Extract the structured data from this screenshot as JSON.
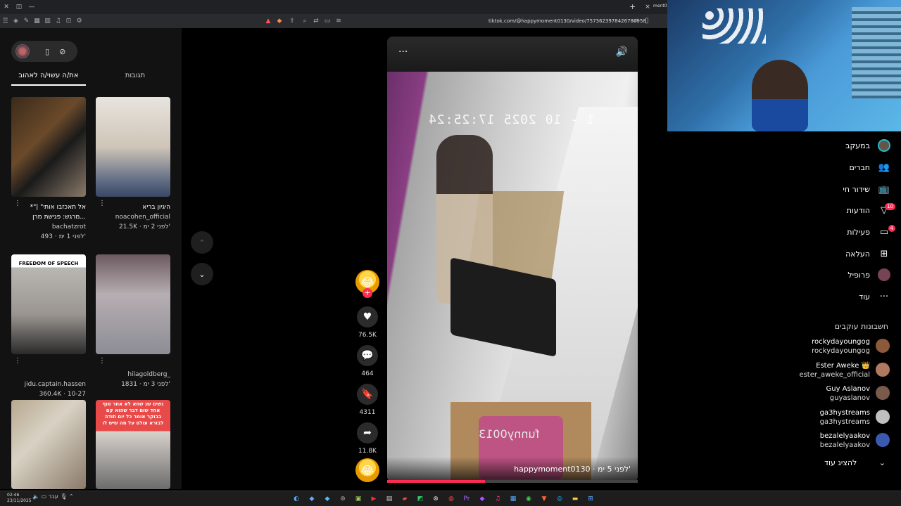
{
  "browser": {
    "url": "tiktok.com/@happymoment0130/video/7573623978426780958",
    "tab_title": "ment0",
    "new_tab": "+",
    "tab_close": "×"
  },
  "left_panel": {
    "tabs": [
      {
        "label": "את/ה עשוי/ה לאהוב"
      },
      {
        "label": "תגובות"
      }
    ],
    "cards": [
      {
        "title": "*\"אל תאכזבו אותי\" | מרגש: פגישת מרן...",
        "author": "bachatzrot",
        "meta": "493 · לפני 1 ימ'"
      },
      {
        "title": "היגיון בריא",
        "author": "noacohen_official",
        "meta": "21.5K · לפני 2 ימ'"
      },
      {
        "title": "",
        "author": "jidu.captain.hassen",
        "meta": "360.4K · 10-27",
        "thumb_text": "FREEDOM OF SPEECH"
      },
      {
        "title": "",
        "author": "hilagoldberg_",
        "meta": "1831 · לפני 3 ימ'"
      },
      {
        "title": "",
        "author": "",
        "meta": ""
      },
      {
        "title": "",
        "author": "",
        "meta": "",
        "thumb_text": "נשים שנ שחא לא אחר סוף אחד שום דבר שהוא קם בבוקר אומר כל יום תודה לבורא עולם על מה שיש לו"
      }
    ]
  },
  "video": {
    "timestamp": "1 - 10 2025 17:25:24",
    "watermark": "funny0013",
    "caption": "happymoment0130 · לפני 5 ימ'",
    "progress": 0.39,
    "dots": "···",
    "sound_icon": "volume-icon"
  },
  "actions": {
    "likes": "76.5K",
    "comments": "464",
    "bookmarks": "4311",
    "shares": "11.8K",
    "follow": "+"
  },
  "right_nav": {
    "items": [
      {
        "label": "במעקב",
        "icon": "following-avatar-icon"
      },
      {
        "label": "חברים",
        "icon": "friends-icon"
      },
      {
        "label": "שידור חי",
        "icon": "live-icon"
      },
      {
        "label": "הודעות",
        "icon": "messages-icon",
        "badge": "10"
      },
      {
        "label": "פעילות",
        "icon": "activity-icon",
        "badge": "4"
      },
      {
        "label": "העלאה",
        "icon": "upload-icon"
      },
      {
        "label": "פרופיל",
        "icon": "profile-icon"
      },
      {
        "label": "עוד",
        "icon": "more-icon"
      }
    ],
    "section_title": "חשבונות עוקבים",
    "following": [
      {
        "name": "rockydayoungog",
        "handle": "rockydayoungog",
        "color": "#8a5a3a"
      },
      {
        "name": "Ester Aweke 👑",
        "handle": "ester_aweke_official",
        "color": "#b07a60"
      },
      {
        "name": "Guy Aslanov",
        "handle": "guyaslanov",
        "color": "#7a5a4a"
      },
      {
        "name": "ga3hystreams",
        "handle": "ga3hystreams",
        "color": "#c0c0c0"
      },
      {
        "name": "bezalelyaakov",
        "handle": "bezalelyaakov",
        "color": "#3a5ab0"
      }
    ],
    "show_more": "להציג עוד"
  },
  "taskbar": {
    "time": "02:46",
    "date": "23/11/2025",
    "lang": "עבר"
  },
  "colors": {
    "accent": "#fe2c55",
    "background": "#000000",
    "panel": "#121212"
  }
}
